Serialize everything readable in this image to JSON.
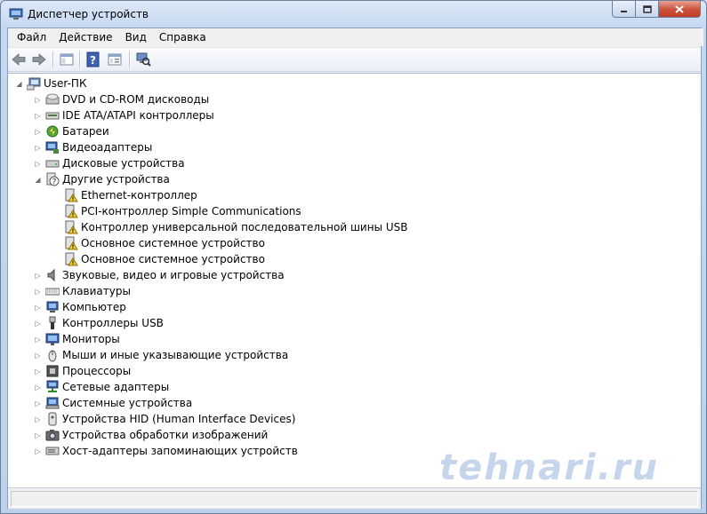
{
  "window": {
    "title": "Диспетчер устройств"
  },
  "menu": [
    "Файл",
    "Действие",
    "Вид",
    "Справка"
  ],
  "toolbar": {
    "icons": [
      "back-icon",
      "forward-icon",
      "show-hide-console-tree-icon",
      "help-icon",
      "properties-icon",
      "scan-hardware-icon"
    ]
  },
  "tree": {
    "root": "User-ПК",
    "items": [
      {
        "label": "DVD и CD-ROM дисководы",
        "icon": "dvd-drive-icon",
        "expanded": false
      },
      {
        "label": "IDE ATA/ATAPI контроллеры",
        "icon": "ide-controller-icon",
        "expanded": false
      },
      {
        "label": "Батареи",
        "icon": "battery-icon",
        "expanded": false
      },
      {
        "label": "Видеоадаптеры",
        "icon": "display-adapter-icon",
        "expanded": false
      },
      {
        "label": "Дисковые устройства",
        "icon": "disk-drive-icon",
        "expanded": false
      },
      {
        "label": "Другие устройства",
        "icon": "unknown-device-icon",
        "expanded": true,
        "children": [
          {
            "label": "Ethernet-контроллер",
            "icon": "warning-device-icon"
          },
          {
            "label": "PCI-контроллер Simple Communications",
            "icon": "warning-device-icon"
          },
          {
            "label": "Контроллер универсальной последовательной шины USB",
            "icon": "warning-device-icon"
          },
          {
            "label": "Основное системное устройство",
            "icon": "warning-device-icon"
          },
          {
            "label": "Основное системное устройство",
            "icon": "warning-device-icon"
          }
        ]
      },
      {
        "label": "Звуковые, видео и игровые устройства",
        "icon": "sound-icon",
        "expanded": false
      },
      {
        "label": "Клавиатуры",
        "icon": "keyboard-icon",
        "expanded": false
      },
      {
        "label": "Компьютер",
        "icon": "computer-icon",
        "expanded": false
      },
      {
        "label": "Контроллеры USB",
        "icon": "usb-icon",
        "expanded": false
      },
      {
        "label": "Мониторы",
        "icon": "monitor-icon",
        "expanded": false
      },
      {
        "label": "Мыши и иные указывающие устройства",
        "icon": "mouse-icon",
        "expanded": false
      },
      {
        "label": "Процессоры",
        "icon": "processor-icon",
        "expanded": false
      },
      {
        "label": "Сетевые адаптеры",
        "icon": "network-adapter-icon",
        "expanded": false
      },
      {
        "label": "Системные устройства",
        "icon": "system-device-icon",
        "expanded": false
      },
      {
        "label": "Устройства HID (Human Interface Devices)",
        "icon": "hid-icon",
        "expanded": false
      },
      {
        "label": "Устройства обработки изображений",
        "icon": "camera-icon",
        "expanded": false
      },
      {
        "label": "Хост-адаптеры запоминающих устройств",
        "icon": "storage-controller-icon",
        "expanded": false
      }
    ]
  },
  "watermark": "tehnari.ru"
}
